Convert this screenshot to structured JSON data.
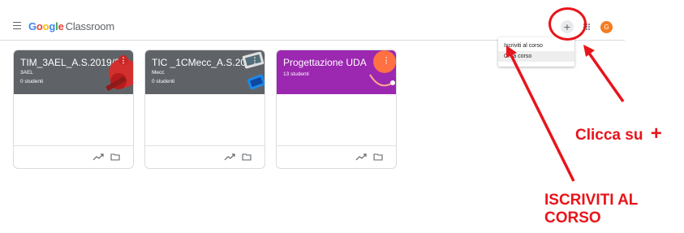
{
  "app": {
    "logo_google": "Google",
    "logo_suffix": "Classroom",
    "avatar_letter": "G",
    "create_join_label": "+"
  },
  "menu": {
    "items": [
      "Iscriviti al corso",
      "Crea corso"
    ]
  },
  "courses": [
    {
      "title": "TIM_3AEL_A.S.2019/20",
      "section": "3AEL",
      "students": "0 studenti",
      "color": "#5f6368"
    },
    {
      "title": "TIC _1CMecc_A.S.201...",
      "section": "Mecc",
      "students": "0 studenti",
      "color": "#5f6368"
    },
    {
      "title": "Progettazione UDA",
      "section": "",
      "students": "13 studenti",
      "color": "#9c27b0"
    }
  ],
  "annotations": {
    "clicca": "Clicca su",
    "plus": "+",
    "iscriviti_line1": "ISCRIVITI AL",
    "iscriviti_line2": "CORSO"
  },
  "colors": {
    "annotation_red": "#e8141b",
    "card_grey": "#5f6368",
    "card_purple": "#9c27b0",
    "avatar_orange": "#f47c20"
  },
  "icons": {
    "kebab": "⋮",
    "trend": "trending-up-icon",
    "folder": "folder-icon"
  }
}
